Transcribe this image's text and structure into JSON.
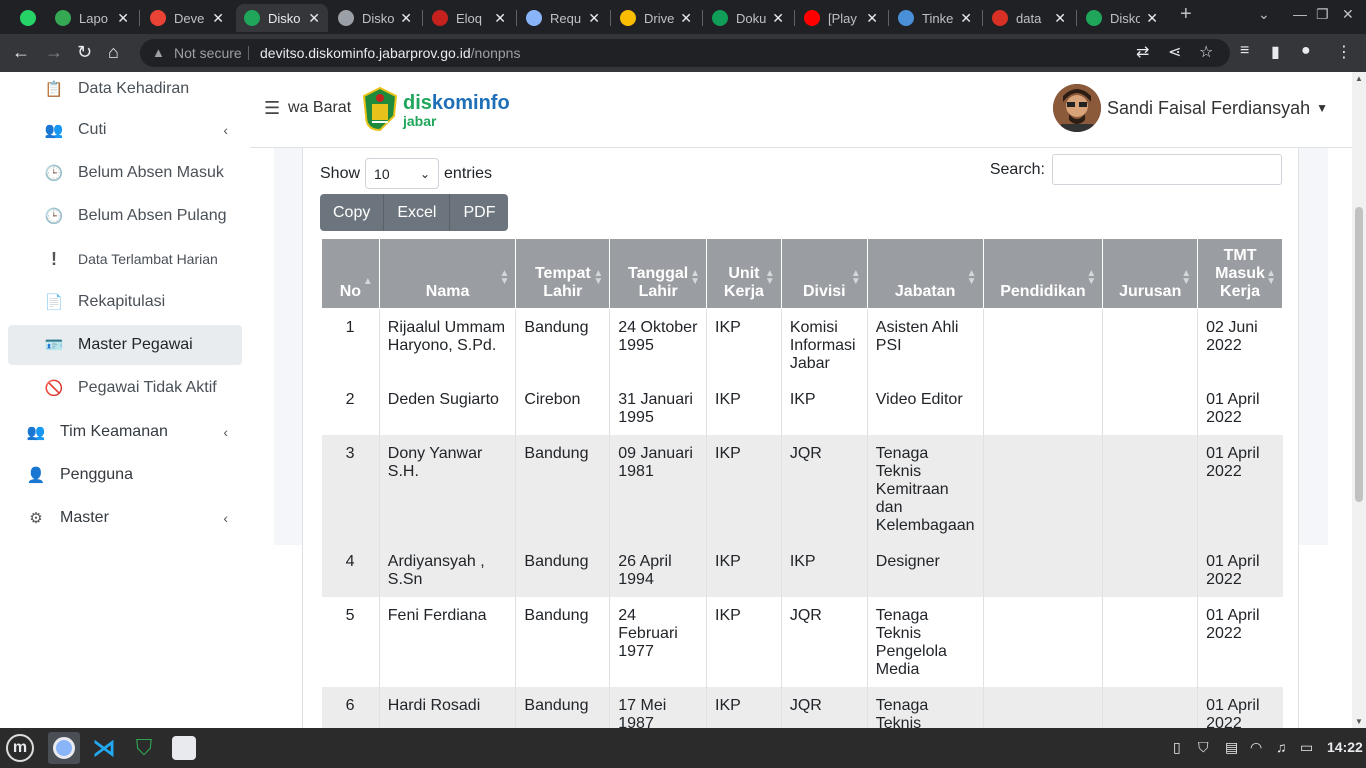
{
  "browser": {
    "tabs": [
      {
        "title": "Lapo",
        "color": "#34a853"
      },
      {
        "title": "Deve",
        "color": "#ea4335"
      },
      {
        "title": "Disko",
        "color": "#1fa65a",
        "active": true
      },
      {
        "title": "Disko",
        "color": "#9aa0a6"
      },
      {
        "title": "Eloq",
        "color": "#c5221f"
      },
      {
        "title": "Requ",
        "color": "#8ab4f8"
      },
      {
        "title": "Drive",
        "color": "#fbbc04"
      },
      {
        "title": "Doku",
        "color": "#0f9d58"
      },
      {
        "title": "[Play",
        "color": "#ff0000"
      },
      {
        "title": "Tinke",
        "color": "#4a90d9"
      },
      {
        "title": "data",
        "color": "#d93025"
      },
      {
        "title": "Disko",
        "color": "#1fa65a"
      }
    ],
    "new_tab": "+",
    "not_secure": "Not secure",
    "url_host": "devitso.diskominfo.jabarprov.go.id",
    "url_path": "/nonpns"
  },
  "sidebar": {
    "items": [
      {
        "label": "Data Kehadiran",
        "icon": "clipboard-icon",
        "glyph": "📋"
      },
      {
        "label": "Cuti",
        "icon": "users-icon",
        "glyph": "👥",
        "chevron": "‹"
      },
      {
        "label": "Belum Absen Masuk",
        "icon": "clock-icon",
        "glyph": "🕒"
      },
      {
        "label": "Belum Absen Pulang",
        "icon": "clock-icon",
        "glyph": "🕒"
      },
      {
        "label": "Data Terlambat Harian",
        "icon": "exclamation-icon",
        "glyph": "!"
      },
      {
        "label": "Rekapitulasi",
        "icon": "file-icon",
        "glyph": "📄"
      },
      {
        "label": "Master Pegawai",
        "icon": "id-card-icon",
        "glyph": "🪪"
      },
      {
        "label": "Pegawai Tidak Aktif",
        "icon": "user-slash-icon",
        "glyph": "🚫"
      },
      {
        "label": "Tim Keamanan",
        "icon": "users-icon",
        "glyph": "👥",
        "chevron": "‹"
      },
      {
        "label": "Pengguna",
        "icon": "user-plus-icon",
        "glyph": "👤"
      },
      {
        "label": "Master",
        "icon": "gear-icon",
        "glyph": "⚙",
        "chevron": "‹"
      }
    ]
  },
  "header": {
    "brand_text": "wa Barat",
    "logo_d": "dis",
    "logo_k": "kominfo",
    "logo_j": "jabar",
    "user_name": "Sandi Faisal Ferdiansyah",
    "caret": "▼"
  },
  "table_controls": {
    "show": "Show",
    "entries_value": "10",
    "entries": "entries",
    "search": "Search:",
    "buttons": [
      "Copy",
      "Excel",
      "PDF"
    ]
  },
  "table": {
    "headers": [
      "No",
      "Nama",
      "Tempat Lahir",
      "Tanggal Lahir",
      "Unit Kerja",
      "Divisi",
      "Jabatan",
      "Pendidikan",
      "Jurusan",
      "TMT Masuk Kerja"
    ],
    "rows": [
      [
        "1",
        "Rijaalul Ummam Haryono, S.Pd.",
        "Bandung",
        "24 Oktober 1995",
        "IKP",
        "Komisi Informasi Jabar",
        "Asisten Ahli PSI",
        "",
        "",
        "02 Juni 2022"
      ],
      [
        "2",
        "Deden Sugiarto",
        "Cirebon",
        "31 Januari 1995",
        "IKP",
        "IKP",
        "Video Editor",
        "",
        "",
        "01 April 2022"
      ],
      [
        "3",
        "Dony Yanwar S.H.",
        "Bandung",
        "09 Januari 1981",
        "IKP",
        "JQR",
        "Tenaga Teknis Kemitraan dan Kelembagaan",
        "",
        "",
        "01 April 2022"
      ],
      [
        "4",
        "Ardiyansyah , S.Sn",
        "Bandung",
        "26 April 1994",
        "IKP",
        "IKP",
        "Designer",
        "",
        "",
        "01 April 2022"
      ],
      [
        "5",
        "Feni Ferdiana",
        "Bandung",
        "24 Februari 1977",
        "IKP",
        "JQR",
        "Tenaga Teknis Pengelola Media",
        "",
        "",
        "01 April 2022"
      ],
      [
        "6",
        "Hardi Rosadi",
        "Bandung",
        "17 Mei 1987",
        "IKP",
        "JQR",
        "Tenaga Teknis Pengelola",
        "",
        "",
        "01 April 2022"
      ]
    ]
  },
  "taskbar": {
    "clock": "14:22"
  }
}
